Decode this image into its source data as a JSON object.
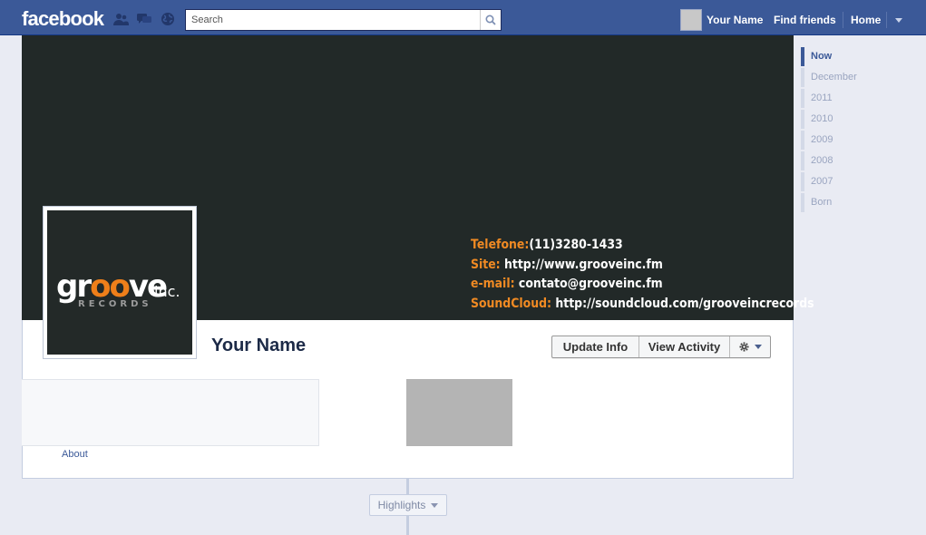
{
  "topbar": {
    "logo": "facebook",
    "search_placeholder": "Search",
    "user_name": "Your Name",
    "find_friends": "Find friends",
    "home": "Home",
    "colors": {
      "bar": "#3b5998"
    }
  },
  "cover": {
    "contact": [
      {
        "label": "Telefone:",
        "value": "(11)3280-1433"
      },
      {
        "label": "Site:",
        "value": " http://www.grooveinc.fm"
      },
      {
        "label": "e-mail:",
        "value": " contato@grooveinc.fm"
      },
      {
        "label": "SoundCloud:",
        "value": " http://soundcloud.com/grooveincrecords"
      }
    ]
  },
  "profile": {
    "logo": {
      "word_start": "gr",
      "word_o": "oo",
      "word_end": "ve",
      "suffix": "inc.",
      "subtitle": "RECORDS"
    },
    "name": "Your Name",
    "actions": {
      "update_info": "Update Info",
      "view_activity": "View Activity"
    },
    "about_link": "About"
  },
  "timeline": {
    "highlights": "Highlights"
  },
  "scrubber": {
    "items": [
      "Now",
      "December",
      "2011",
      "2010",
      "2009",
      "2008",
      "2007",
      "Born"
    ],
    "active_index": 0
  }
}
